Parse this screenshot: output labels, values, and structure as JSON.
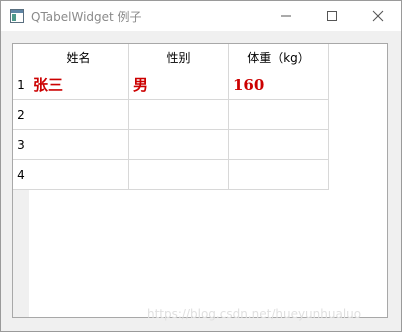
{
  "window": {
    "title": "QTabelWidget 例子",
    "icons": {
      "app": "app-window-icon",
      "minimize": "minimize-icon",
      "maximize": "maximize-icon",
      "close": "close-icon"
    }
  },
  "table": {
    "columns": [
      "姓名",
      "性别",
      "体重（kg）"
    ],
    "row_labels": [
      "1",
      "2",
      "3",
      "4"
    ],
    "rows": [
      [
        "张三",
        "男",
        "160"
      ],
      [
        "",
        "",
        ""
      ],
      [
        "",
        "",
        ""
      ],
      [
        "",
        "",
        ""
      ]
    ],
    "cell_text_color": "#cc0000"
  },
  "watermark": "https://blog.csdn.net/hueyunhualuo"
}
